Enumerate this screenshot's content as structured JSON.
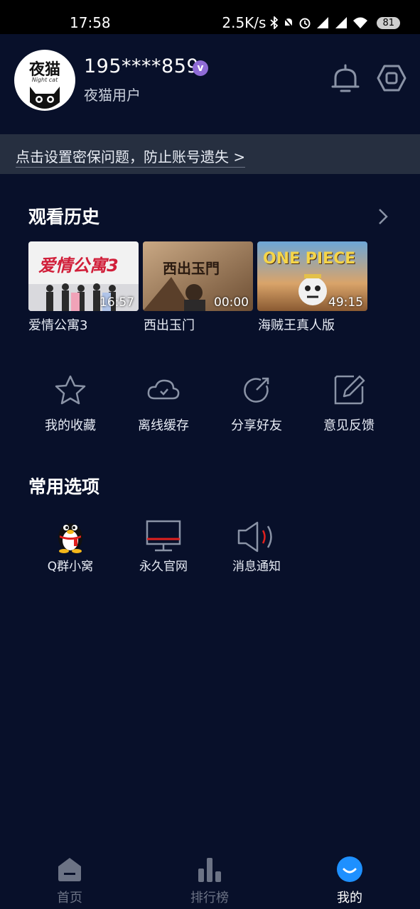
{
  "status_bar": {
    "time": "17:58",
    "network_speed": "2.5K/s",
    "battery": "81"
  },
  "profile": {
    "avatar_brand": "夜猫",
    "avatar_subtext": "Night cat",
    "username": "195****859",
    "vip_badge": "v",
    "user_tag": "夜猫用户"
  },
  "notice": {
    "text": "点击设置密保问题，防止账号遗失 >"
  },
  "history": {
    "title": "观看历史",
    "items": [
      {
        "title": "爱情公寓3",
        "duration": "16:57",
        "poster_text": "爱情公寓3"
      },
      {
        "title": "西出玉门",
        "duration": "00:00",
        "poster_text": "西出玉門"
      },
      {
        "title": "海贼王真人版",
        "duration": "49:15",
        "poster_text": "ONE PIECE"
      }
    ]
  },
  "quick_actions": [
    {
      "label": "我的收藏",
      "icon": "star-icon"
    },
    {
      "label": "离线缓存",
      "icon": "cloud-download-icon"
    },
    {
      "label": "分享好友",
      "icon": "share-icon"
    },
    {
      "label": "意见反馈",
      "icon": "edit-icon"
    }
  ],
  "common_options": {
    "title": "常用选项",
    "items": [
      {
        "label": "Q群小窝",
        "icon": "qq-penguin-icon"
      },
      {
        "label": "永久官网",
        "icon": "monitor-icon"
      },
      {
        "label": "消息通知",
        "icon": "speaker-icon"
      }
    ]
  },
  "tab_bar": {
    "tabs": [
      {
        "label": "首页",
        "icon": "home-icon",
        "active": false
      },
      {
        "label": "排行榜",
        "icon": "chart-icon",
        "active": false
      },
      {
        "label": "我的",
        "icon": "profile-icon",
        "active": true
      }
    ]
  },
  "colors": {
    "background": "#08102a",
    "notice_bar": "#262f40",
    "accent_blue": "#1e90ff",
    "vip_purple": "#8f6bd6",
    "inactive_tab": "#6c7385"
  }
}
